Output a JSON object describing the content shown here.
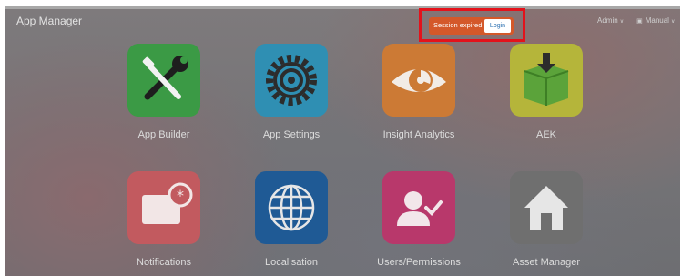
{
  "header": {
    "app_title": "App Manager",
    "session": {
      "message": "Session expired",
      "login_label": "Login"
    },
    "user_menu": {
      "admin_label": "Admin",
      "manual_label": "Manual"
    }
  },
  "tiles": [
    {
      "label": "App Builder",
      "icon": "tools-icon",
      "color": "#3b9a45"
    },
    {
      "label": "App Settings",
      "icon": "gear-icon",
      "color": "#2f8fb3"
    },
    {
      "label": "Insight Analytics",
      "icon": "eye-icon",
      "color": "#cc7a35"
    },
    {
      "label": "AEK",
      "icon": "box-icon",
      "color": "#b5b53a"
    },
    {
      "label": "Notifications",
      "icon": "notification-icon",
      "color": "#c25a5f"
    },
    {
      "label": "Localisation",
      "icon": "globe-icon",
      "color": "#1f5a95"
    },
    {
      "label": "Users/Permissions",
      "icon": "user-check-icon",
      "color": "#b8386b"
    },
    {
      "label": "Asset Manager",
      "icon": "home-icon",
      "color": "#6f6f6f"
    }
  ],
  "colors": {
    "highlight_border": "#e3121b",
    "session_bg": "#d4582a"
  }
}
